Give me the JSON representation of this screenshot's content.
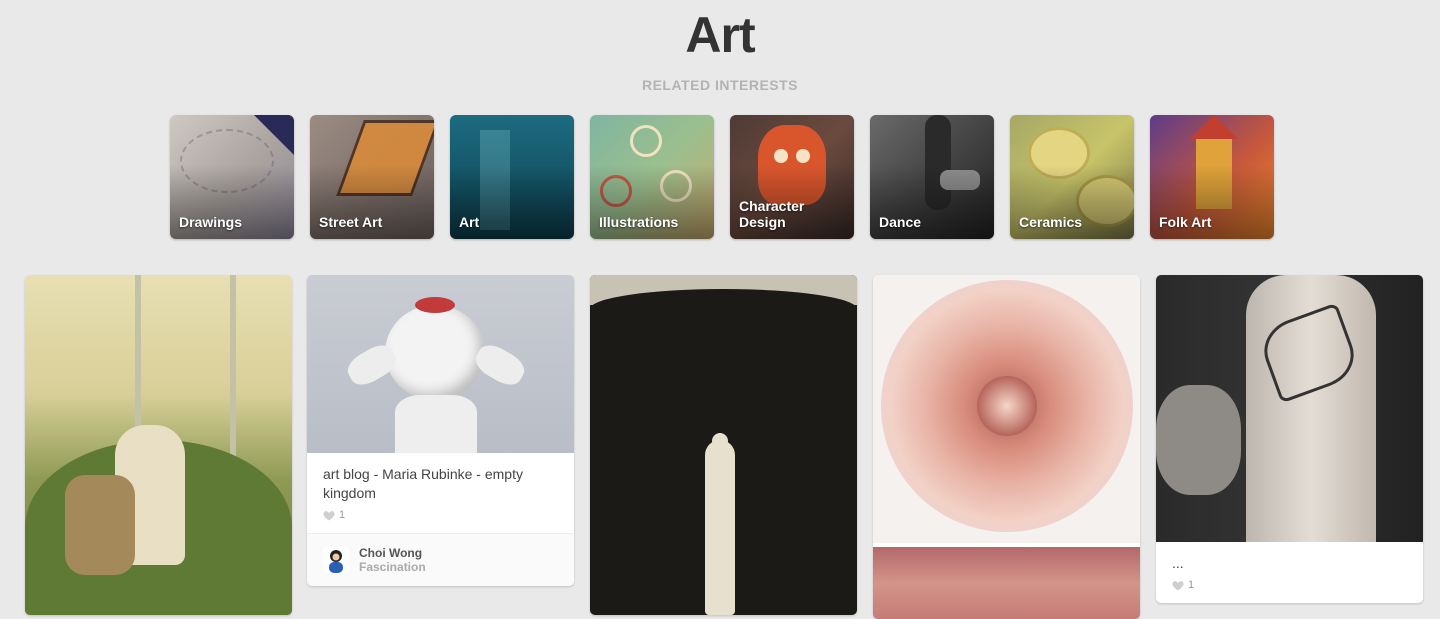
{
  "page": {
    "title": "Art",
    "related_label": "RELATED INTERESTS"
  },
  "interests": [
    {
      "label": "Drawings"
    },
    {
      "label": "Street Art"
    },
    {
      "label": "Art"
    },
    {
      "label": "Illustrations"
    },
    {
      "label": "Character Design"
    },
    {
      "label": "Dance"
    },
    {
      "label": "Ceramics"
    },
    {
      "label": "Folk Art"
    }
  ],
  "pins": [
    {
      "description": "",
      "likes": ""
    },
    {
      "description": "art blog - Maria Rubinke - empty kingdom",
      "likes": "1",
      "pinner": {
        "name": "Choi Wong",
        "board": "Fascination"
      }
    },
    {
      "description": "",
      "likes": ""
    },
    {
      "description": "",
      "likes": ""
    },
    {
      "description": "...",
      "likes": "1"
    }
  ],
  "colors": {
    "background": "#e9e9e9",
    "title": "#333333",
    "subtitle": "#b3b3b3"
  },
  "icons": [
    "heart-icon"
  ]
}
